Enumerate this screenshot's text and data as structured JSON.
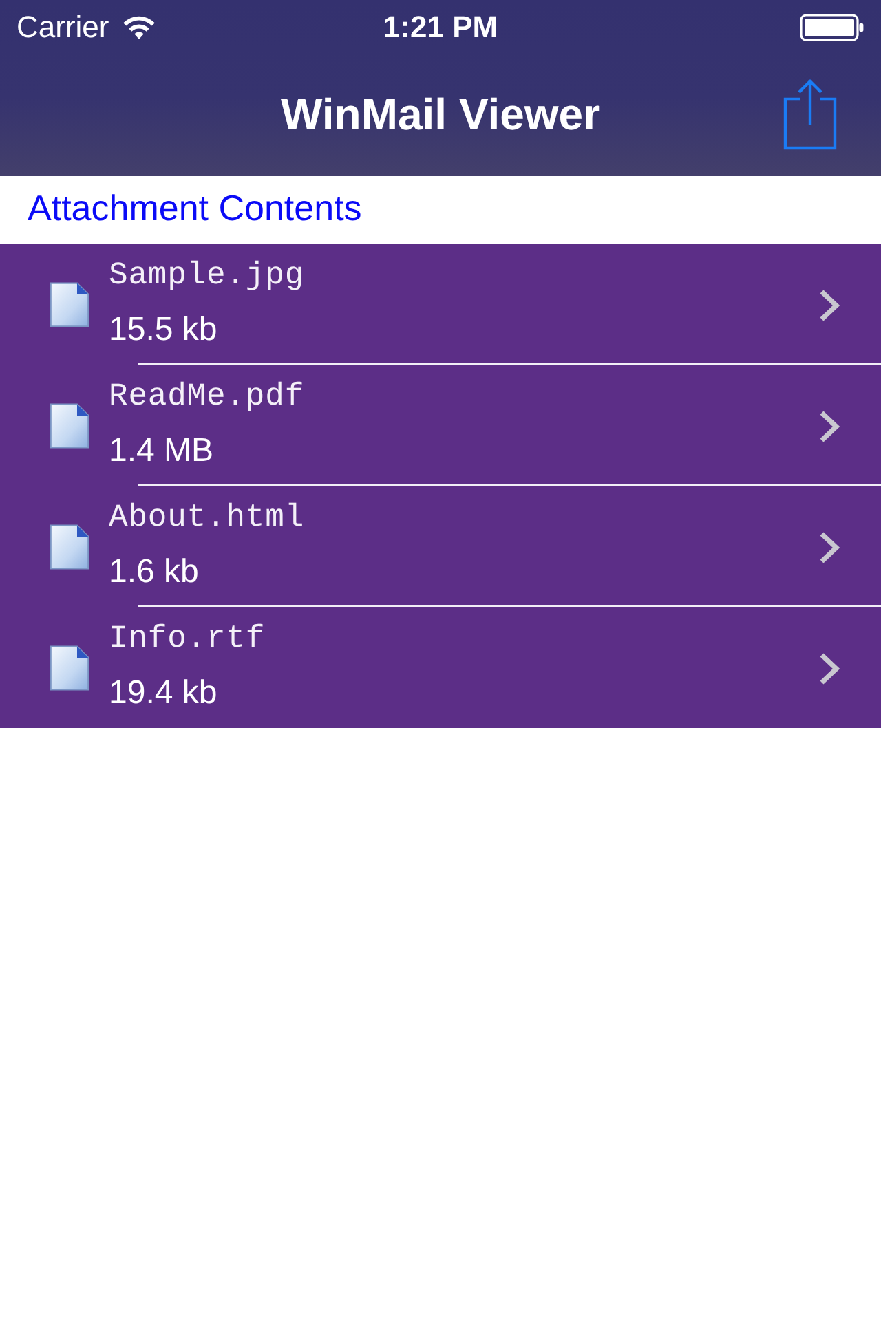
{
  "status_bar": {
    "carrier": "Carrier",
    "time": "1:21 PM"
  },
  "nav_bar": {
    "title": "WinMail Viewer"
  },
  "section": {
    "title": "Attachment Contents"
  },
  "files": [
    {
      "name": "Sample.jpg",
      "size": "15.5 kb"
    },
    {
      "name": "ReadMe.pdf",
      "size": "1.4 MB"
    },
    {
      "name": "About.html",
      "size": "1.6 kb"
    },
    {
      "name": "Info.rtf",
      "size": "19.4 kb"
    }
  ]
}
